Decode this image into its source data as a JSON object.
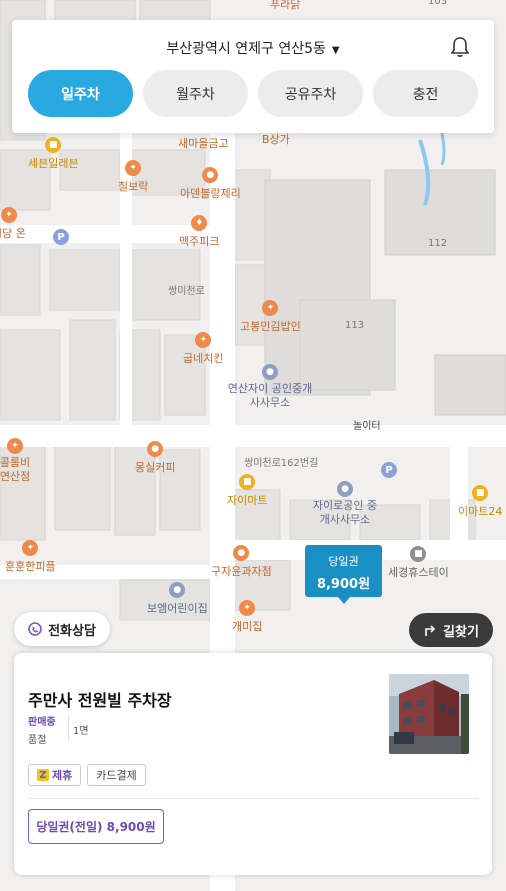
{
  "header": {
    "location": "부산광역시 연제구 연산5동",
    "location_icon": "chevron-down-icon",
    "bell_icon": "bell-icon"
  },
  "tabs": [
    {
      "label": "일주차",
      "active": true
    },
    {
      "label": "월주차",
      "active": false
    },
    {
      "label": "공유주차",
      "active": false
    },
    {
      "label": "충전",
      "active": false
    }
  ],
  "map": {
    "pois": [
      {
        "label": "푸라닭",
        "type": "food"
      },
      {
        "label": "세븐일레븐",
        "type": "store"
      },
      {
        "label": "새마을금고",
        "type": "bank"
      },
      {
        "label": "B상가",
        "type": "building"
      },
      {
        "label": "칠보락",
        "type": "food"
      },
      {
        "label": "아덴블랑제리",
        "type": "food"
      },
      {
        "label": "시당 온",
        "type": "food"
      },
      {
        "label": "맥주피크",
        "type": "bar"
      },
      {
        "label": "고봉민김밥인",
        "type": "food"
      },
      {
        "label": "굽네치킨",
        "type": "food"
      },
      {
        "label": "연산자이 공인중개사사무소",
        "type": "office"
      },
      {
        "label": "몽실커피",
        "type": "cafe"
      },
      {
        "label": "자이마트",
        "type": "store"
      },
      {
        "label": "자이로공인 중개사사무소",
        "type": "office"
      },
      {
        "label": "이마트24",
        "type": "store"
      },
      {
        "label": "훈훈한피플",
        "type": "food"
      },
      {
        "label": "구자윤과자점",
        "type": "food"
      },
      {
        "label": "세경휴스테이",
        "type": "building"
      },
      {
        "label": "보엠어린이집",
        "type": "school"
      },
      {
        "label": "개미집",
        "type": "food"
      },
      {
        "label": "콜롬비 연산점",
        "type": "food"
      }
    ],
    "labels": {
      "road1": "쌍미천로",
      "road2": "쌍미천로162번길",
      "playground": "놀이터",
      "bldg_103": "103",
      "bldg_112": "112",
      "bldg_113": "113"
    },
    "marker": {
      "title": "당일권",
      "price": "8,900원"
    }
  },
  "buttons": {
    "call": "전화상담",
    "route": "길찾기"
  },
  "card": {
    "name": "주만사 전원빌 주차장",
    "status": "판매중",
    "availability": "품절",
    "spaces": "1면",
    "tags": [
      "제휴",
      "카드결제"
    ],
    "ticket": "당일권(전일) 8,900원"
  },
  "colors": {
    "accent": "#28a9e0",
    "marker": "#1a8fc4",
    "purple": "#6a4bb8"
  }
}
